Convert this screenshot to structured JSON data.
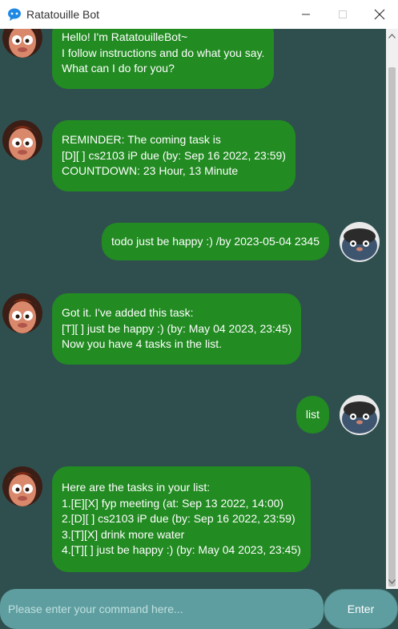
{
  "window": {
    "title": "Ratatouille Bot",
    "icon": "chat-bot-icon"
  },
  "messages": [
    {
      "sender": "bot",
      "text": "Hello! I'm RatatouilleBot~\nI follow instructions and do what you say.\nWhat can I do for you?"
    },
    {
      "sender": "bot",
      "text": "REMINDER: The coming task is\n[D][ ] cs2103 iP due (by: Sep 16 2022, 23:59)\nCOUNTDOWN: 23 Hour, 13 Minute"
    },
    {
      "sender": "user",
      "text": "todo just be happy :) /by 2023-05-04 2345"
    },
    {
      "sender": "bot",
      "text": "Got it. I've added this task:\n[T][ ] just be happy :) (by: May 04 2023, 23:45)\nNow you have 4 tasks in the list."
    },
    {
      "sender": "user",
      "text": "list"
    },
    {
      "sender": "bot",
      "text": "Here are the tasks in your list:\n1.[E][X] fyp meeting (at: Sep 13 2022, 14:00)\n2.[D][ ] cs2103 iP due (by: Sep 16 2022, 23:59)\n3.[T][X] drink more water\n4.[T][ ] just be happy :) (by: May 04 2023, 23:45)"
    }
  ],
  "input": {
    "placeholder": "Please enter your command here...",
    "value": ""
  },
  "enter_button": {
    "label": "Enter"
  },
  "colors": {
    "chat_background": "#2f4f4f",
    "bubble": "#228b22",
    "input": "#5f9ea0"
  }
}
